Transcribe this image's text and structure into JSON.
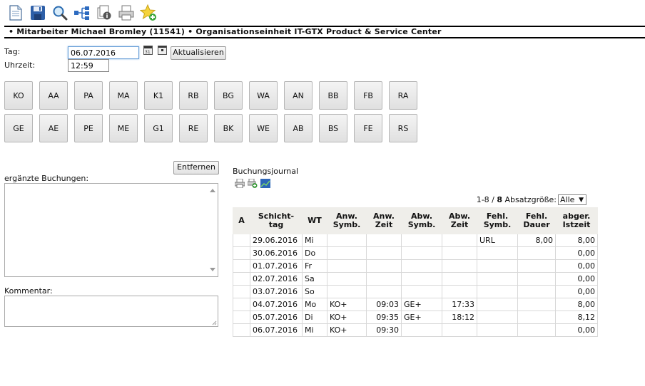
{
  "toolbar": {
    "icons": [
      "new-document-icon",
      "save-icon",
      "search-icon",
      "org-tree-icon",
      "document-info-icon",
      "print-icon",
      "favorite-add-icon"
    ]
  },
  "header": {
    "text": "• Mitarbeiter Michael Bromley (11541) • Organisationseinheit IT-GTX Product & Service Center"
  },
  "form": {
    "tag_label": "Tag:",
    "tag_value": "06.07.2016",
    "uhrzeit_label": "Uhrzeit:",
    "uhrzeit_value": "12:59",
    "refresh_label": "Aktualisieren"
  },
  "booking_buttons": {
    "row1": [
      "KO",
      "AA",
      "PA",
      "MA",
      "K1",
      "RB",
      "BG",
      "WA",
      "AN",
      "BB",
      "FB",
      "RA"
    ],
    "row2": [
      "GE",
      "AE",
      "PE",
      "ME",
      "G1",
      "RE",
      "BK",
      "WE",
      "AB",
      "BS",
      "FE",
      "RS"
    ]
  },
  "left_panel": {
    "remove_label": "Entfernen",
    "added_bookings_label": "ergänzte Buchungen:",
    "comment_label": "Kommentar:"
  },
  "journal": {
    "title": "Buchungsjournal",
    "paging_range": "1-8",
    "paging_sep": " / ",
    "paging_total": "8",
    "page_size_label": "Absatzgröße:",
    "page_size_value": "Alle",
    "columns": [
      "A",
      "Schicht-\ntag",
      "WT",
      "Anw.\nSymb.",
      "Anw.\nZeit",
      "Abw.\nSymb.",
      "Abw.\nZeit",
      "Fehl.\nSymb.",
      "Fehl.\nDauer",
      "abger.\nIstzeit"
    ],
    "rows": [
      [
        "",
        "29.06.2016",
        "Mi",
        "",
        "",
        "",
        "",
        "URL",
        "8,00",
        "8,00"
      ],
      [
        "",
        "30.06.2016",
        "Do",
        "",
        "",
        "",
        "",
        "",
        "",
        "0,00"
      ],
      [
        "",
        "01.07.2016",
        "Fr",
        "",
        "",
        "",
        "",
        "",
        "",
        "0,00"
      ],
      [
        "",
        "02.07.2016",
        "Sa",
        "",
        "",
        "",
        "",
        "",
        "",
        "0,00"
      ],
      [
        "",
        "03.07.2016",
        "So",
        "",
        "",
        "",
        "",
        "",
        "",
        "0,00"
      ],
      [
        "",
        "04.07.2016",
        "Mo",
        "KO+",
        "09:03",
        "GE+",
        "17:33",
        "",
        "",
        "8,00"
      ],
      [
        "",
        "05.07.2016",
        "Di",
        "KO+",
        "09:35",
        "GE+",
        "18:12",
        "",
        "",
        "8,12"
      ],
      [
        "",
        "06.07.2016",
        "Mi",
        "KO+",
        "09:30",
        "",
        "",
        "",
        "",
        "0,00"
      ]
    ]
  }
}
